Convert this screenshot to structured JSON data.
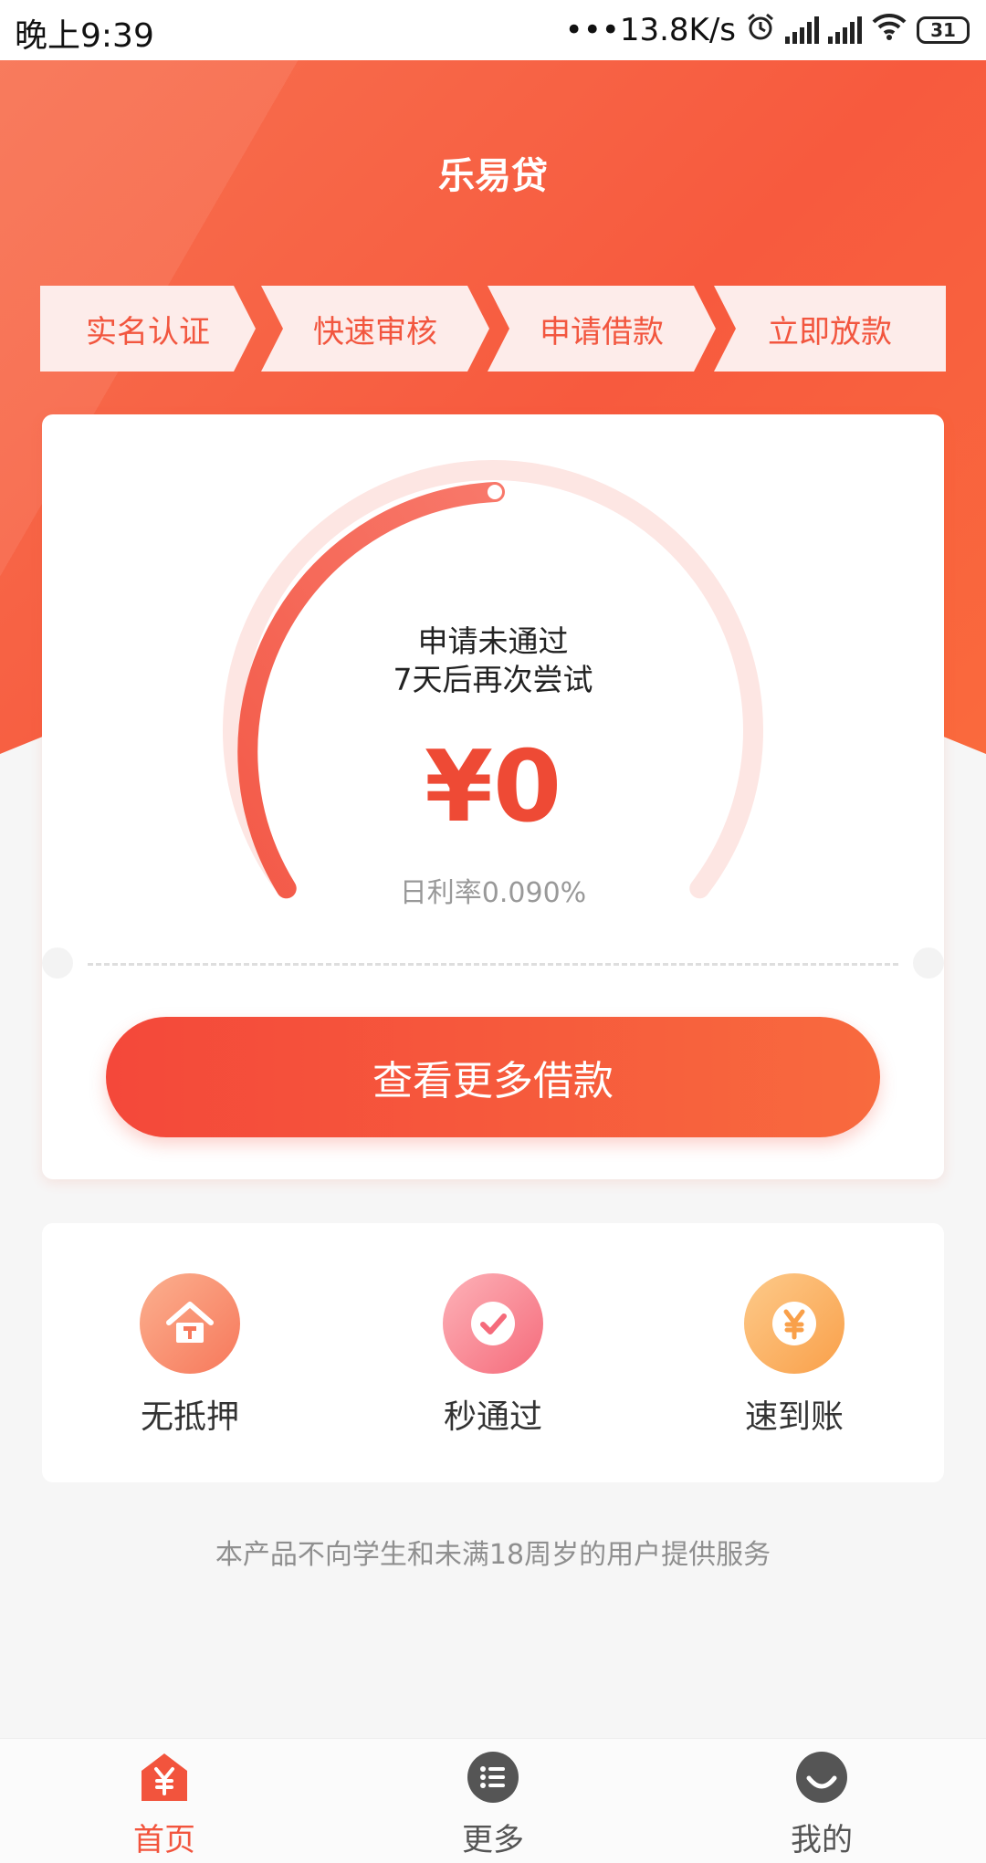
{
  "status_bar": {
    "time": "晚上9:39",
    "net_speed": "•••13.8K/s",
    "battery": "31"
  },
  "header": {
    "title": "乐易贷"
  },
  "steps": [
    "实名认证",
    "快速审核",
    "申请借款",
    "立即放款"
  ],
  "loan_card": {
    "status_line1": "申请未通过",
    "status_line2": "7天后再次尝试",
    "amount": "¥0",
    "daily_rate": "日利率0.090%",
    "cta_label": "查看更多借款"
  },
  "features": [
    {
      "label": "无抵押",
      "icon": "house-icon"
    },
    {
      "label": "秒通过",
      "icon": "checkmark-icon"
    },
    {
      "label": "速到账",
      "icon": "yen-icon"
    }
  ],
  "disclaimer": "本产品不向学生和未满18周岁的用户提供服务",
  "bottom_nav": [
    {
      "label": "首页",
      "icon": "home-yen-icon",
      "active": true
    },
    {
      "label": "更多",
      "icon": "list-icon",
      "active": false
    },
    {
      "label": "我的",
      "icon": "profile-icon",
      "active": false
    }
  ],
  "colors": {
    "brand": "#f75a3e",
    "accent_text": "#ee4a35",
    "step_bg": "#fdecea",
    "nav_active": "#f2543d",
    "nav_inactive": "#555555"
  }
}
